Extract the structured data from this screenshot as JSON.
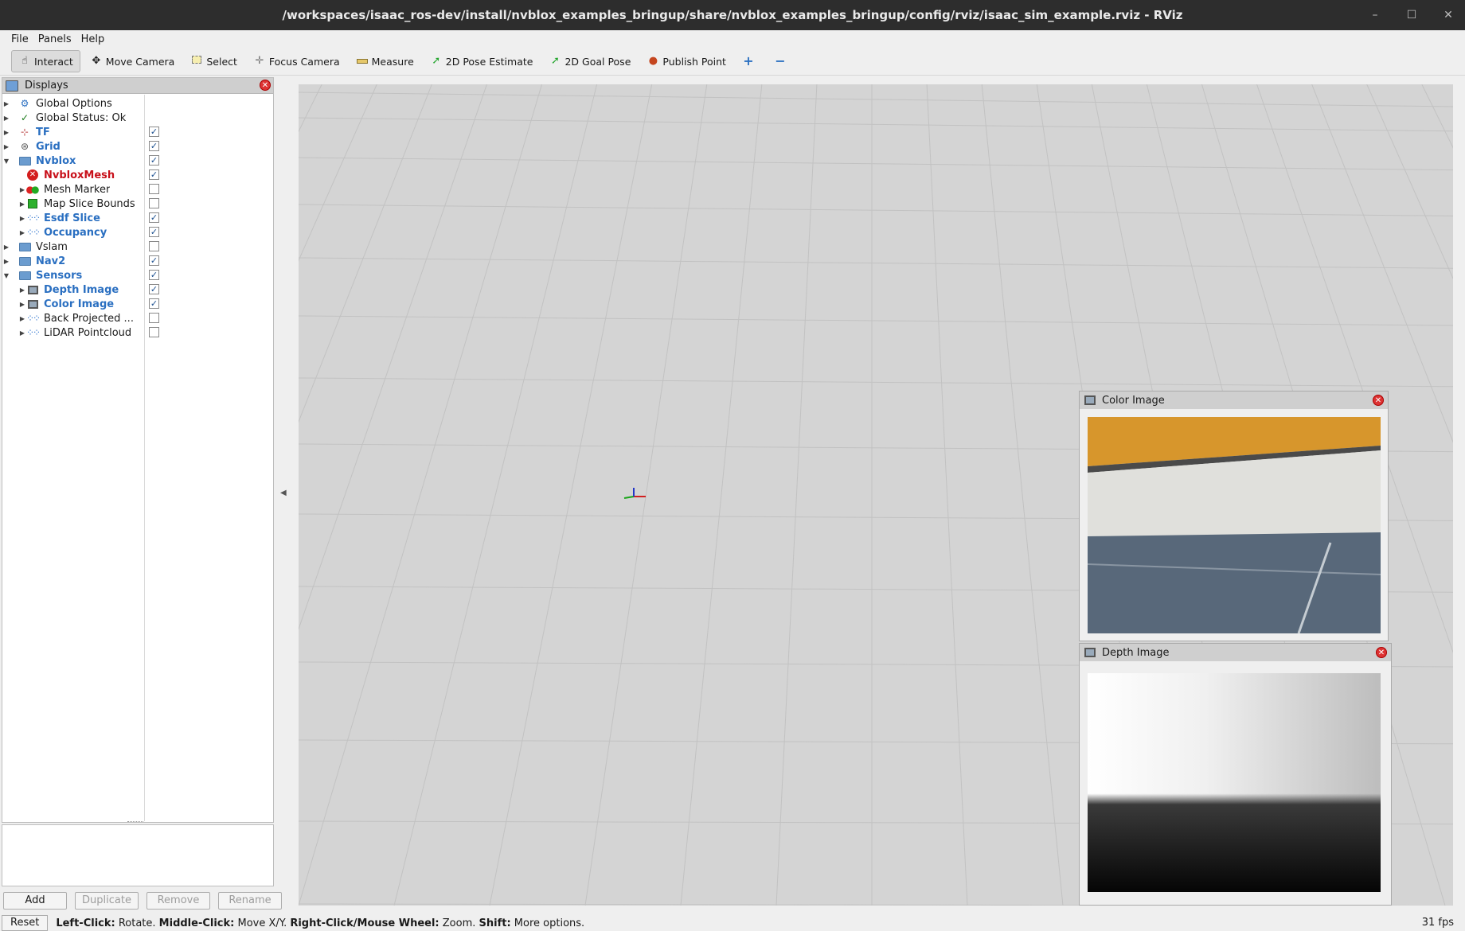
{
  "window": {
    "title": "/workspaces/isaac_ros-dev/install/nvblox_examples_bringup/share/nvblox_examples_bringup/config/rviz/isaac_sim_example.rviz - RViz",
    "minimize": "–",
    "maximize": "☐",
    "close": "✕"
  },
  "menu": {
    "file": "File",
    "panels": "Panels",
    "help": "Help"
  },
  "toolbar": {
    "interact": "Interact",
    "move_camera": "Move Camera",
    "select": "Select",
    "focus_camera": "Focus Camera",
    "measure": "Measure",
    "pose_estimate": "2D Pose Estimate",
    "goal_pose": "2D Goal Pose",
    "publish_point": "Publish Point",
    "add_tool": "+",
    "remove_tool": "−"
  },
  "displays": {
    "title": "Displays",
    "items": [
      {
        "label": "Global Options",
        "icon": "gear-icon",
        "check": ""
      },
      {
        "label": "Global Status: Ok",
        "icon": "check-icon",
        "check": ""
      },
      {
        "label": "TF",
        "icon": "tf-icon",
        "check": "✓"
      },
      {
        "label": "Grid",
        "icon": "grid-icon",
        "check": "✓"
      },
      {
        "label": "Nvblox",
        "icon": "folder-icon",
        "check": "✓"
      },
      {
        "label": "NvbloxMesh",
        "icon": "error-icon",
        "check": "✓"
      },
      {
        "label": "Mesh Marker",
        "icon": "marker-icon",
        "check": ""
      },
      {
        "label": "Map Slice Bounds",
        "icon": "cube-icon",
        "check": ""
      },
      {
        "label": "Esdf Slice",
        "icon": "pointcloud-icon",
        "check": "✓"
      },
      {
        "label": "Occupancy",
        "icon": "pointcloud-icon",
        "check": "✓"
      },
      {
        "label": "Vslam",
        "icon": "folder-icon",
        "check": ""
      },
      {
        "label": "Nav2",
        "icon": "folder-icon",
        "check": "✓"
      },
      {
        "label": "Sensors",
        "icon": "folder-icon",
        "check": "✓"
      },
      {
        "label": "Depth Image",
        "icon": "image-icon",
        "check": "✓"
      },
      {
        "label": "Color Image",
        "icon": "image-icon",
        "check": "✓"
      },
      {
        "label": "Back Projected ...",
        "icon": "pointcloud-icon",
        "check": ""
      },
      {
        "label": "LiDAR Pointcloud",
        "icon": "pointcloud-icon",
        "check": ""
      }
    ]
  },
  "buttons": {
    "add": "Add",
    "duplicate": "Duplicate",
    "remove": "Remove",
    "rename": "Rename"
  },
  "color_panel": {
    "title": "Color Image"
  },
  "depth_panel": {
    "title": "Depth Image"
  },
  "status": {
    "reset": "Reset",
    "left_key": "Left-Click:",
    "left_val": " Rotate. ",
    "mid_key": "Middle-Click:",
    "mid_val": " Move X/Y. ",
    "right_key": "Right-Click/Mouse Wheel:",
    "right_val": " Zoom. ",
    "shift_key": "Shift:",
    "shift_val": " More options.",
    "fps": "31 fps"
  },
  "colors": {
    "title_bar": "#2d2d2d",
    "view_bg": "#d4d4d4",
    "tree_blue": "#2a6fc1",
    "tree_error": "#c8101a"
  }
}
